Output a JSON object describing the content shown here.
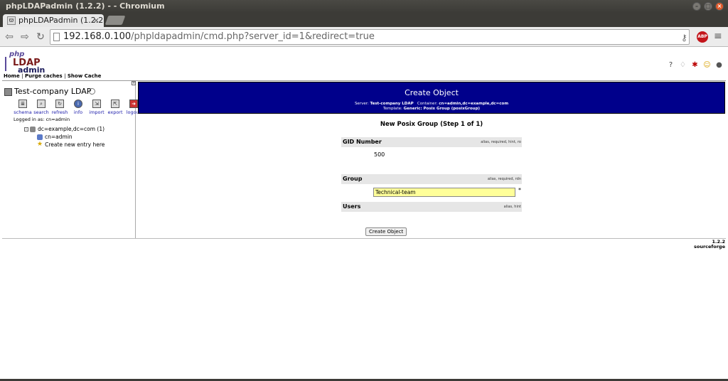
{
  "window": {
    "title": "phpLDAPadmin (1.2.2) - - Chromium"
  },
  "tab": {
    "title": "phpLDAPadmin (1.2.2",
    "close": "×"
  },
  "browser": {
    "url_host": "192.168.0.100",
    "url_path": "/phpldapadmin/cmd.php?server_id=1&redirect=true",
    "abp_label": "ABP"
  },
  "logo": {
    "line1": "php",
    "line2": "LDAP",
    "line3": "admin"
  },
  "navlinks": {
    "home": "Home",
    "purge": "Purge caches",
    "show_cache": "Show Cache",
    "sep": "|"
  },
  "sidebar": {
    "server_name": "Test-company LDAP",
    "tools": [
      {
        "label": "schema",
        "icon": "schema-icon"
      },
      {
        "label": "search",
        "icon": "search-icon"
      },
      {
        "label": "refresh",
        "icon": "refresh-icon"
      },
      {
        "label": "info",
        "icon": "info-icon"
      },
      {
        "label": "import",
        "icon": "import-icon"
      },
      {
        "label": "export",
        "icon": "export-icon"
      },
      {
        "label": "logout",
        "icon": "logout-icon"
      }
    ],
    "logged_in_label": "Logged in as:",
    "logged_in_user": "cn=admin",
    "tree": {
      "root": "dc=example,dc=com (1)",
      "child": "cn=admin",
      "create": "Create new entry here"
    }
  },
  "main": {
    "title": "Create Object",
    "server_label": "Server:",
    "server_value": "Test-company LDAP",
    "container_label": "Container:",
    "container_value": "cn=admin,dc=example,dc=com",
    "template_label": "Template:",
    "template_value": "Generic: Posix Group (posixGroup)",
    "step_title": "New Posix Group (Step 1 of 1)",
    "attributes": {
      "gid": {
        "label": "GID Number",
        "hint": "alias, required, hint, ro",
        "value": "500"
      },
      "group": {
        "label": "Group",
        "hint": "alias, required, rdn",
        "value": "Technical-team",
        "required_mark": "*"
      },
      "users": {
        "label": "Users",
        "hint": "alias, hint"
      }
    },
    "submit_label": "Create Object"
  },
  "footer": {
    "version": "1.2.2",
    "sourceforge": "sourceforge"
  }
}
